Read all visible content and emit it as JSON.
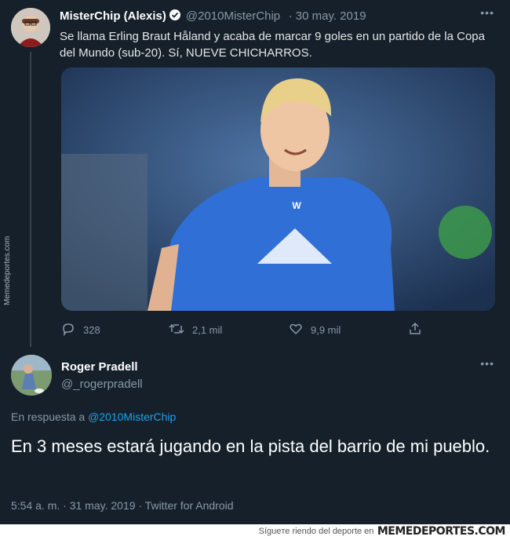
{
  "tweet": {
    "name": "MisterChip (Alexis)",
    "handle": "@2010MisterChip",
    "date": "· 30 may. 2019",
    "text": "Se llama Erling Braut Håland y acaba de marcar 9 goles en un partido de la Copa del Mundo (sub-20). Sí, NUEVE CHICHARROS.",
    "replies": "328",
    "retweets": "2,1 mil",
    "likes": "9,9 mil"
  },
  "reply": {
    "name": "Roger Pradell",
    "handle": "@_rogerpradell",
    "reply_prefix": "En respuesta a",
    "reply_target": "@2010MisterChip",
    "text": "En 3 meses estará jugando en la pista del barrio de mi pueblo.",
    "meta": "5:54 a. m. · 31 may. 2019 · Twitter for Android"
  },
  "watermark": {
    "side": "Memedeportes.com",
    "footer_prefix": "Sígueте riendo del deporte en",
    "footer_brand": "MEMEDEPORTES.COM"
  },
  "colors": {
    "background": "#15202b",
    "link": "#1da1f2",
    "secondary": "#8899a6"
  }
}
